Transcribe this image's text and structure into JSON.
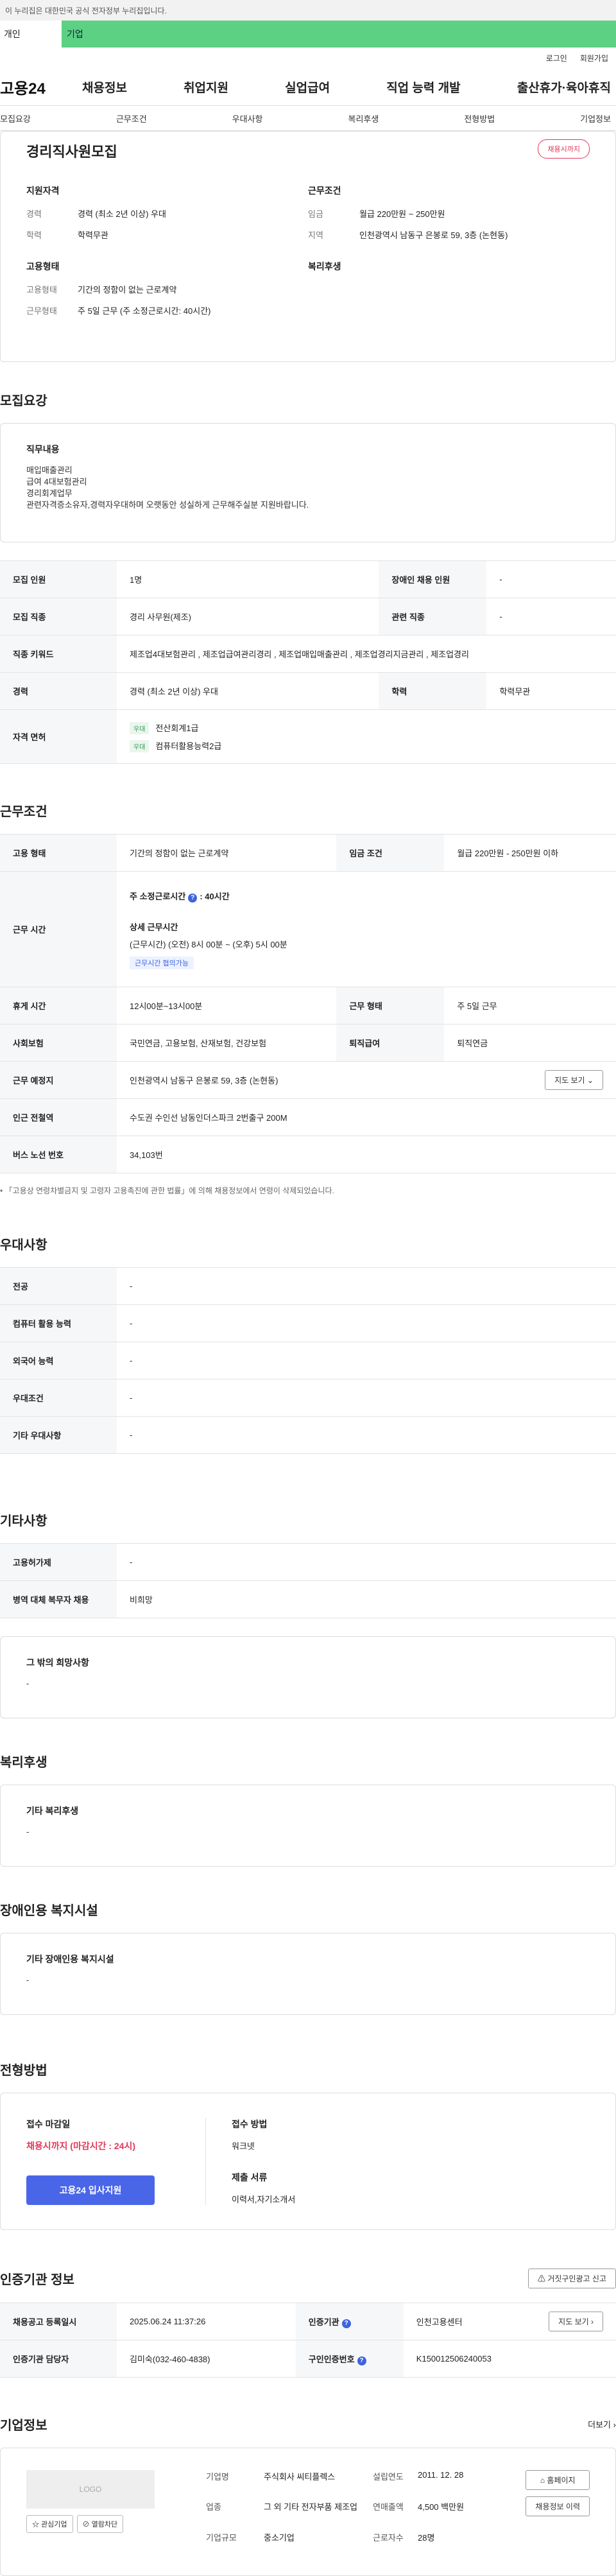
{
  "gov_banner": "이 누리집은 대한민국 공식 전자정부 누리집입니다.",
  "top_tabs": {
    "a": "개인",
    "b": "기업"
  },
  "util": {
    "login": "로그인",
    "join": "회원가입"
  },
  "logo": "고용24",
  "gnb": [
    "채용정보",
    "취업지원",
    "실업급여",
    "직업 능력 개발",
    "출산휴가·육아휴직"
  ],
  "subnav": [
    "모집요강",
    "근무조건",
    "우대사항",
    "복리후생",
    "전형방법",
    "기업정보"
  ],
  "summary": {
    "title": "경리직사원모집",
    "deadline_badge": "채용시까지",
    "qual_title": "지원자격",
    "qual": [
      {
        "k": "경력",
        "v": "경력 (최소 2년 이상) 우대"
      },
      {
        "k": "학력",
        "v": "학력무관"
      }
    ],
    "emp_title": "고용형태",
    "emp": [
      {
        "k": "고용형태",
        "v": "기간의 정함이 없는 근로계약"
      },
      {
        "k": "근무형태",
        "v": "주 5일 근무 (주 소정근로시간: 40시간)"
      }
    ],
    "cond_title": "근무조건",
    "cond": [
      {
        "k": "임금",
        "v": "월급 220만원 ~ 250만원"
      },
      {
        "k": "지역",
        "v": "인천광역시 남동구 은봉로 59, 3층 (논현동)"
      }
    ],
    "welfare_title": "복리후생"
  },
  "recruit": {
    "title": "모집요강",
    "duty_title": "직무내용",
    "duty_lines": [
      "매입매출관리",
      "급여 4대보험관리",
      "경리회계업무",
      "관련자격증소유자,경력자우대하며 오랫동안 성실하게 근무해주실분 지원바랍니다."
    ],
    "rows": {
      "headcount_k": "모집 인원",
      "headcount_v": "1명",
      "disabled_k": "장애인 채용 인원",
      "disabled_v": "-",
      "job_k": "모집 직종",
      "job_v": "경리 사무원(제조)",
      "related_k": "관련 직종",
      "related_v": "-",
      "keyword_k": "직종 키워드",
      "keyword_v": "제조업4대보험관리 , 제조업급여관리경리 , 제조업매입매출관리 , 제조업경리지금관리 , 제조업경리",
      "career_k": "경력",
      "career_v": "경력 (최소 2년 이상) 우대",
      "edu_k": "학력",
      "edu_v": "학력무관",
      "license_k": "자격 면허",
      "licenses": [
        {
          "tag": "우대",
          "name": "전산회계1급"
        },
        {
          "tag": "우대",
          "name": "컴퓨터활용능력2급"
        }
      ]
    }
  },
  "work": {
    "title": "근무조건",
    "type_k": "고용 형태",
    "type_v": "기간의 정함이 없는 근로계약",
    "wage_k": "임금 조건",
    "wage_v": "월급 220만원 - 250만원 이하",
    "hours_k": "근무 시간",
    "hours_main": "주 소정근로시간",
    "hours_main_v": ": 40시간",
    "hours_detail_title": "상세 근무시간",
    "hours_detail": "(근무시간) (오전) 8시 00분 ~ (오후) 5시 00분",
    "hours_tag": "근무시간 협의가능",
    "rest_k": "휴게 시간",
    "rest_v": "12시00분~13시00분",
    "shift_k": "근무 형태",
    "shift_v": "주 5일 근무",
    "insur_k": "사회보험",
    "insur_v": "국민연금, 고용보험, 산재보험, 건강보험",
    "retire_k": "퇴직급여",
    "retire_v": "퇴직연금",
    "place_k": "근무 예정지",
    "place_v": "인천광역시 남동구 은봉로 59, 3층 (논현동)",
    "map_btn": "지도 보기",
    "station_k": "인근 전철역",
    "station_v": "수도권 수인선 남동인더스파크 2번출구 200M",
    "bus_k": "버스 노선 번호",
    "bus_v": "34,103번",
    "note": "• 「고용상 연령차별금지 및 고령자 고용촉진에 관한 법률」에 의해 채용정보에서 연령이 삭제되었습니다."
  },
  "pref": {
    "title": "우대사항",
    "rows": [
      {
        "k": "전공",
        "v": "-"
      },
      {
        "k": "컴퓨터 활용 능력",
        "v": "-"
      },
      {
        "k": "외국어 능력",
        "v": "-"
      },
      {
        "k": "우대조건",
        "v": "-"
      },
      {
        "k": "기타 우대사항",
        "v": "-"
      }
    ]
  },
  "etc": {
    "title": "기타사항",
    "rows": [
      {
        "k": "고용허가제",
        "v": "-"
      },
      {
        "k": "병역 대체 복무자 채용",
        "v": "비희망"
      }
    ],
    "other_title": "그 밖의 희망사항",
    "other_v": "-"
  },
  "welfare": {
    "title": "복리후생",
    "box_title": "기타 복리후생",
    "box_v": "-"
  },
  "disab": {
    "title": "장애인용 복지시설",
    "box_title": "기타 장애인용 복지시설",
    "box_v": "-"
  },
  "selection": {
    "title": "전형방법",
    "deadline_title": "접수 마감일",
    "deadline_v": "채용시까지 (마감시간 : 24시)",
    "apply_btn": "고용24 입사지원",
    "method_title": "접수 방법",
    "method_v": "워크넷",
    "docs_title": "제출 서류",
    "docs_v": "이력서,자기소개서"
  },
  "agency": {
    "title": "인증기관 정보",
    "report_btn": "거짓구인광고 신고",
    "reg_k": "채용공고 등록일시",
    "reg_v": "2025.06.24 11:37:26",
    "org_k": "인증기관",
    "org_v": "인천고용센터",
    "map_btn": "지도 보기",
    "staff_k": "인증기관 담당자",
    "staff_v": "김미숙(032-460-4838)",
    "cert_k": "구인인증번호",
    "cert_v": "K150012506240053"
  },
  "company": {
    "title": "기업정보",
    "more": "더보기",
    "logo_text": "LOGO",
    "fav_btn": "관심기업",
    "block_btn": "열람차단",
    "info": [
      {
        "k": "기업명",
        "v": "주식회사 씨티플렉스"
      },
      {
        "k": "설립연도",
        "v": "2011. 12. 28"
      },
      {
        "k": "업종",
        "v": "그 외 기타 전자부품 제조업"
      },
      {
        "k": "연매출액",
        "v": "4,500 백만원"
      },
      {
        "k": "기업규모",
        "v": "중소기업"
      },
      {
        "k": "근로자수",
        "v": "28명"
      }
    ],
    "home_btn": "홈페이지",
    "history_btn": "채용정보 이력"
  }
}
